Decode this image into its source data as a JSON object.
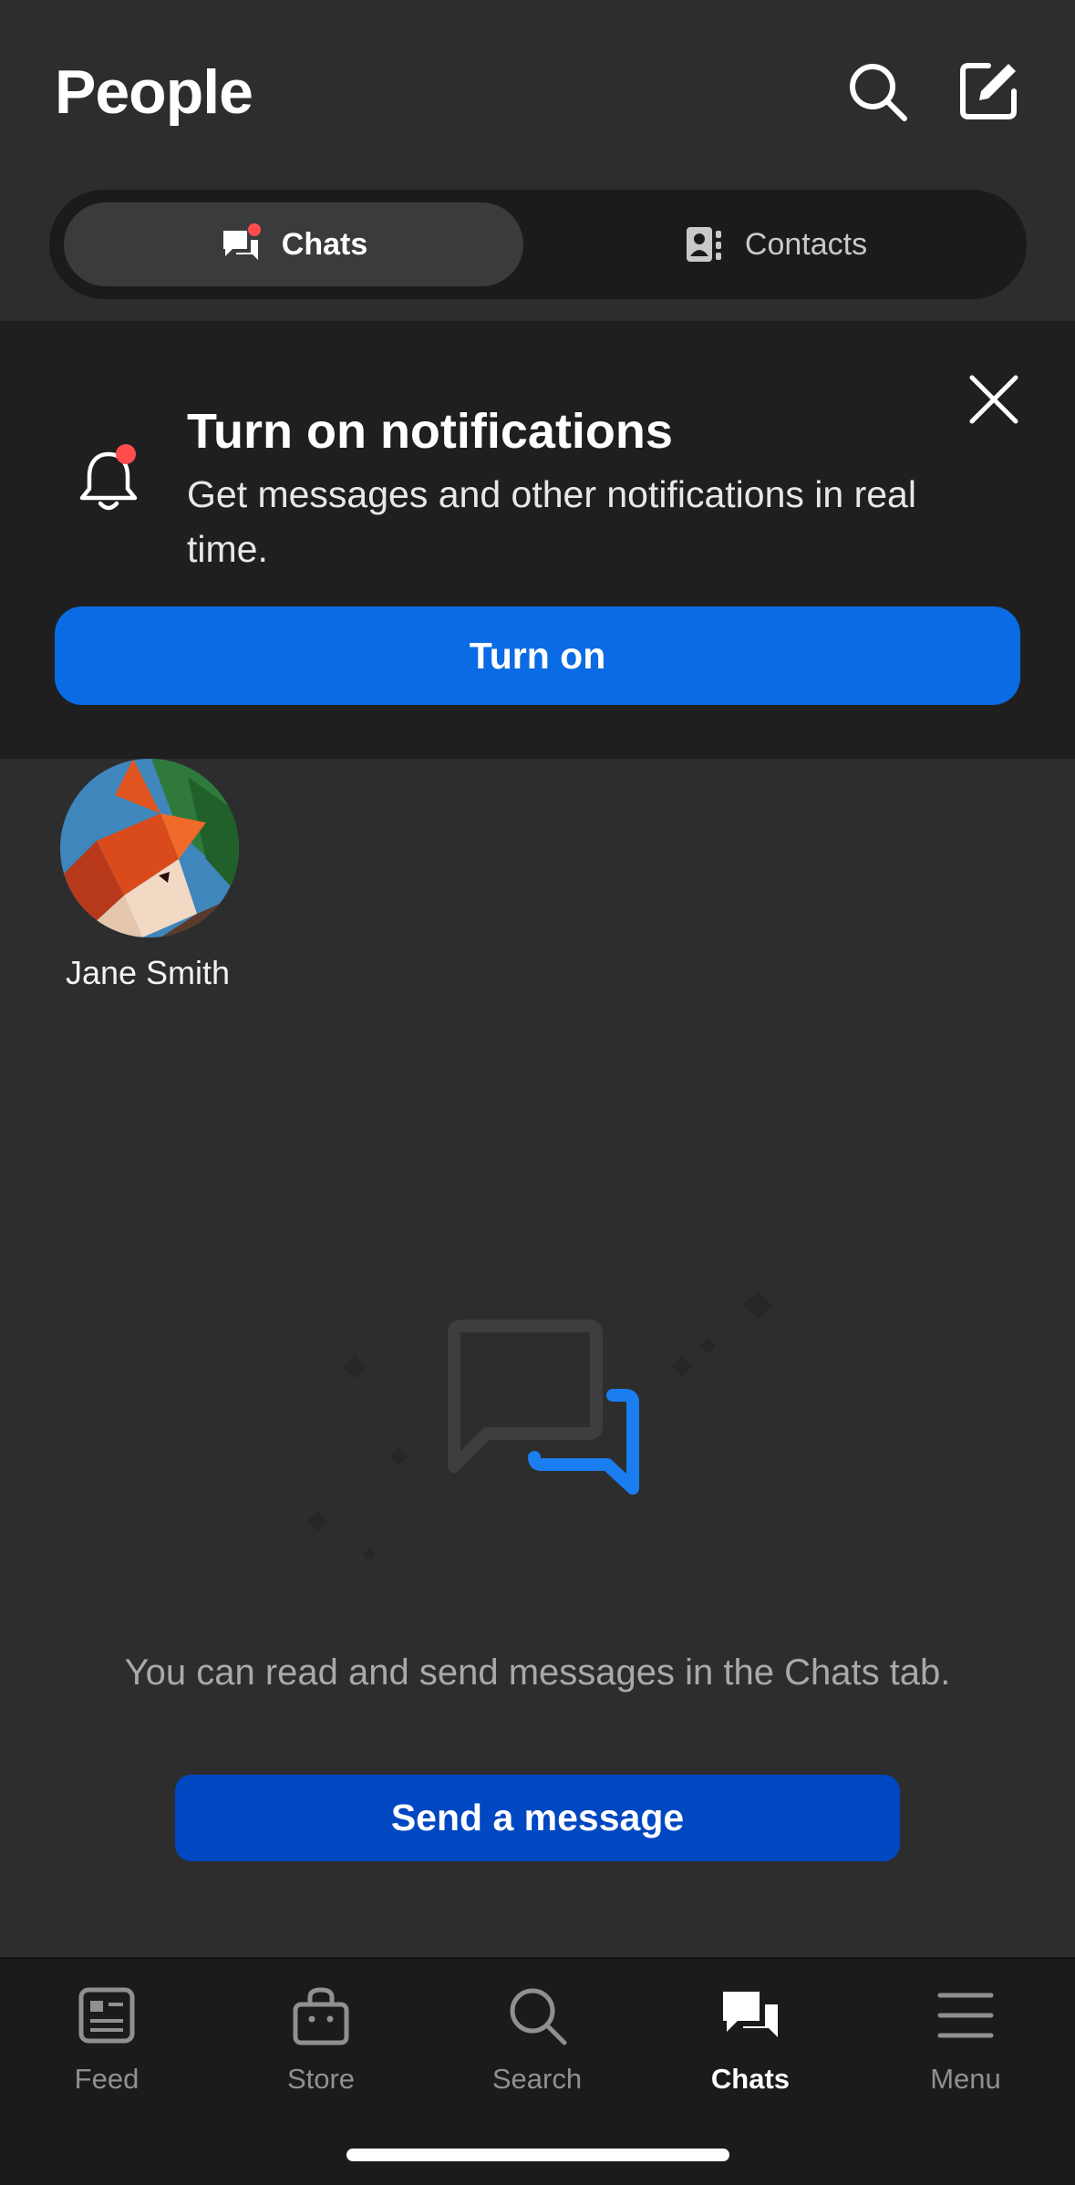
{
  "header": {
    "title": "People",
    "search_icon": "search-icon",
    "compose_icon": "compose-icon"
  },
  "segments": {
    "chats_label": "Chats",
    "contacts_label": "Contacts",
    "active": "Chats"
  },
  "notification_banner": {
    "title": "Turn on notifications",
    "body": "Get messages and other notifications in real time.",
    "button_label": "Turn on",
    "accent_color": "#0a6be4",
    "badge_color": "#ff4d4d"
  },
  "recent_contacts": [
    {
      "name": "Jane Smith",
      "avatar": "fox-avatar"
    }
  ],
  "empty_state": {
    "message": "You can read and send messages in the Chats tab.",
    "button_label": "Send a message",
    "button_color": "#0047c2"
  },
  "bottom_nav": {
    "items": [
      {
        "label": "Feed",
        "icon": "feed-icon"
      },
      {
        "label": "Store",
        "icon": "store-icon"
      },
      {
        "label": "Search",
        "icon": "search-icon"
      },
      {
        "label": "Chats",
        "icon": "chats-icon"
      },
      {
        "label": "Menu",
        "icon": "menu-icon"
      }
    ],
    "active": "Chats"
  }
}
